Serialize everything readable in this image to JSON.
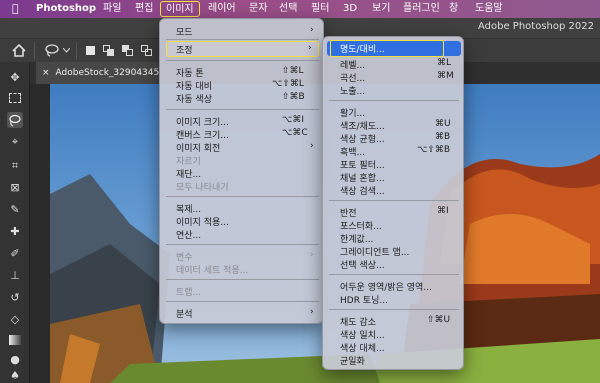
{
  "menubar": {
    "apple": "",
    "app": "Photoshop",
    "file": "파일",
    "edit": "편집",
    "image": "이미지",
    "layer": "레이어",
    "type": "문자",
    "select": "선택",
    "filter": "필터",
    "threed": "3D",
    "view": "보기",
    "plugins": "플러그인",
    "window": "창",
    "help": "도움말"
  },
  "title_bar": {
    "title": "Adobe Photoshop 2022"
  },
  "document_tab": {
    "name": "AdobeStock_329043458("
  },
  "image_menu": {
    "mode": "모드",
    "adjustments": "조정",
    "auto_tone": "자동 톤",
    "auto_tone_sc": "⇧⌘L",
    "auto_contrast": "자동 대비",
    "auto_contrast_sc": "⌥⇧⌘L",
    "auto_color": "자동 색상",
    "auto_color_sc": "⇧⌘B",
    "image_size": "이미지 크기...",
    "image_size_sc": "⌥⌘I",
    "canvas_size": "캔버스 크기...",
    "canvas_size_sc": "⌥⌘C",
    "image_rotation": "이미지 회전",
    "crop": "자르기",
    "trim": "재단...",
    "reveal_all": "모두 나타내기",
    "duplicate": "복제...",
    "apply_image": "이미지 적용...",
    "calculations": "연산...",
    "variables": "변수",
    "apply_data_set": "데이터 세트 적용...",
    "trap": "트랩...",
    "analysis": "분석"
  },
  "adjustments_menu": {
    "brightness_contrast": "명도/대비...",
    "levels": "레벨...",
    "levels_sc": "⌘L",
    "curves": "곡선...",
    "curves_sc": "⌘M",
    "exposure": "노출...",
    "vibrance": "활기...",
    "hue_saturation": "색조/채도...",
    "hue_saturation_sc": "⌘U",
    "color_balance": "색상 균형...",
    "color_balance_sc": "⌘B",
    "black_white": "흑백...",
    "black_white_sc": "⌥⇧⌘B",
    "photo_filter": "포토 필터...",
    "channel_mixer": "채널 혼합...",
    "color_lookup": "색상 검색...",
    "invert": "반전",
    "invert_sc": "⌘I",
    "posterize": "포스터화...",
    "threshold": "한계값...",
    "gradient_map": "그레이디언트 맵...",
    "selective_color": "선택 색상...",
    "shadows_highlights": "어두운 영역/밝은 영역...",
    "hdr_toning": "HDR 토닝...",
    "desaturate": "채도 감소",
    "desaturate_sc": "⇧⌘U",
    "match_color": "색상 일치...",
    "replace_color": "색상 대체...",
    "equalize": "균일화"
  },
  "colors": {
    "menubar": "#8c4a8c",
    "highlight": "#2f6fe0",
    "callout": "#f6e23a"
  },
  "icons": [
    "apple-logo-icon",
    "home-icon",
    "lasso-icon",
    "chevron-down-icon",
    "move-tool-icon",
    "marquee-tool-icon",
    "lasso-tool-icon",
    "quick-selection-icon",
    "crop-tool-icon",
    "frame-tool-icon",
    "eyedropper-icon",
    "healing-brush-icon",
    "brush-icon",
    "clone-stamp-icon",
    "history-brush-icon",
    "eraser-icon",
    "gradient-icon",
    "blur-icon",
    "dodge-icon",
    "pen-icon",
    "submenu-arrow-icon"
  ]
}
